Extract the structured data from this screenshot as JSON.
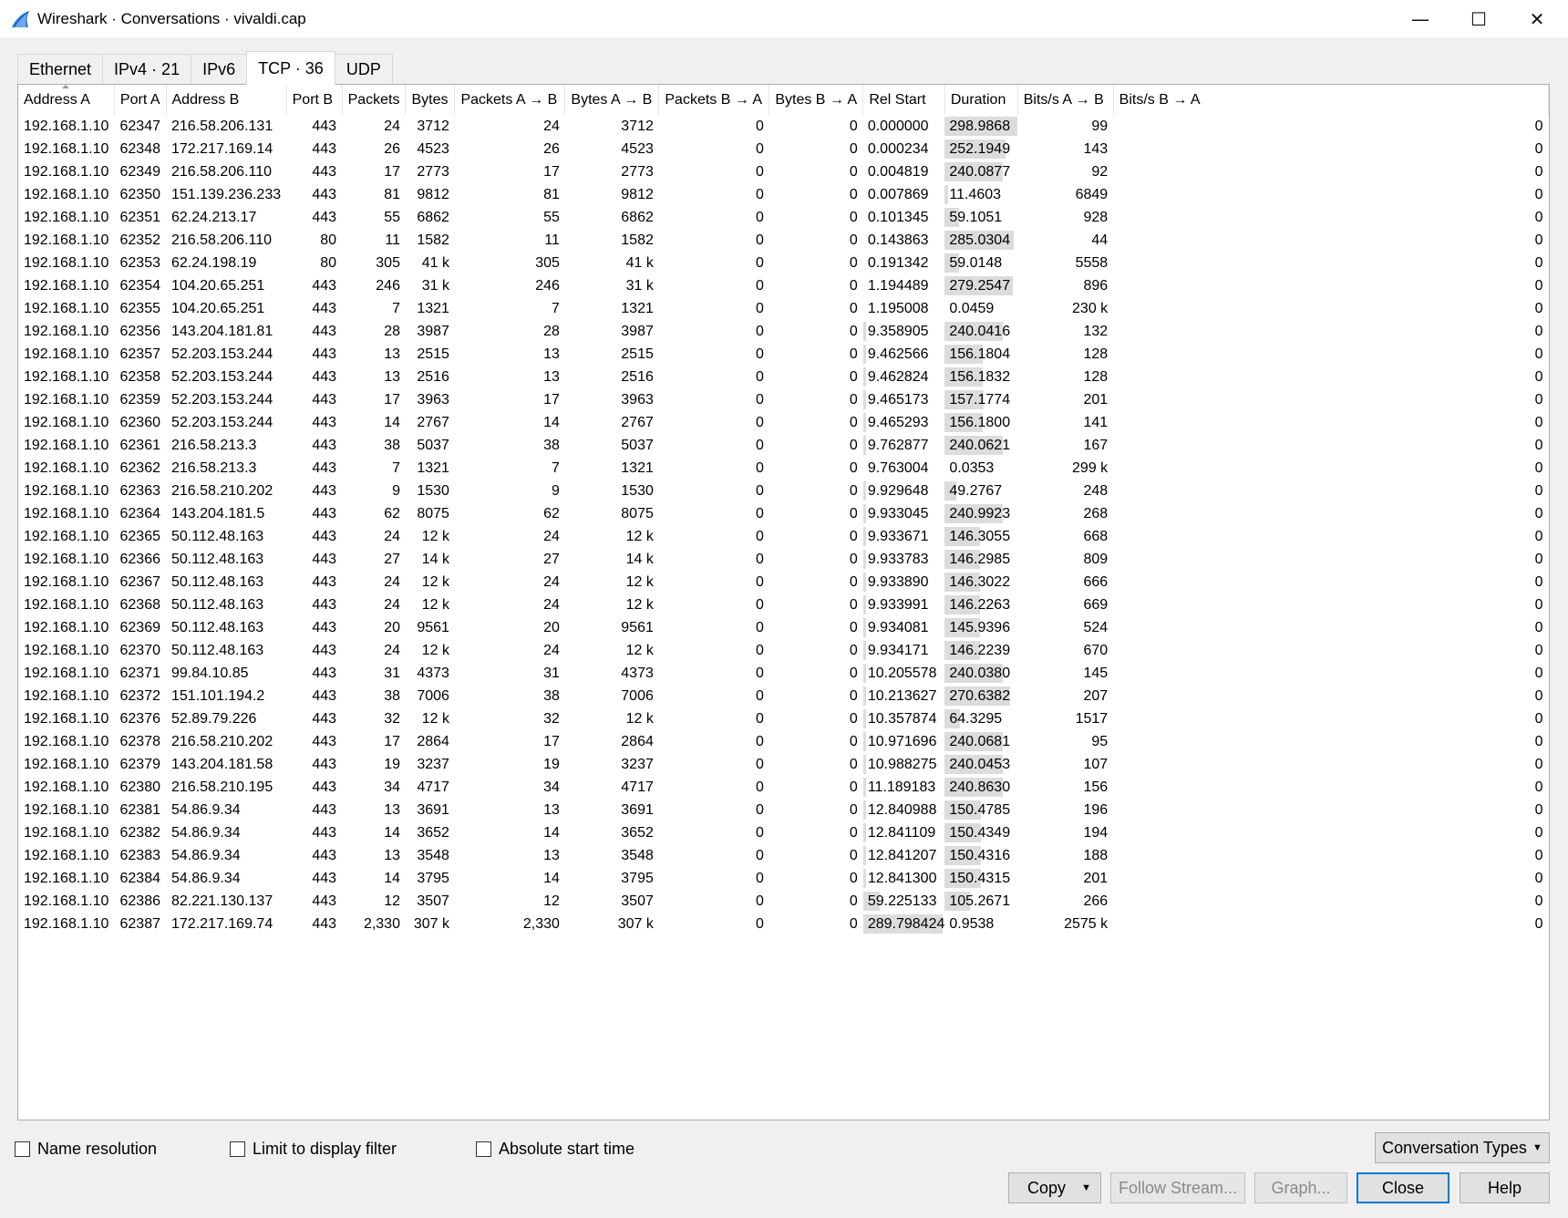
{
  "window": {
    "title": "Wireshark · Conversations · vivaldi.cap",
    "minimize_glyph": "—",
    "maximize_glyph": "☐",
    "close_glyph": "✕"
  },
  "tabs": [
    {
      "label": "Ethernet",
      "active": false
    },
    {
      "label": "IPv4 · 21",
      "active": false
    },
    {
      "label": "IPv6",
      "active": false
    },
    {
      "label": "TCP · 36",
      "active": true
    },
    {
      "label": "UDP",
      "active": false
    }
  ],
  "columns": [
    "Address A",
    "Port A",
    "Address B",
    "Port B",
    "Packets",
    "Bytes",
    "Packets A → B",
    "Bytes A → B",
    "Packets B → A",
    "Bytes B → A",
    "Rel Start",
    "Duration",
    "Bits/s A → B",
    "Bits/s B → A"
  ],
  "rows": [
    [
      "192.168.1.10",
      "62347",
      "216.58.206.131",
      "443",
      "24",
      "3712",
      "24",
      "3712",
      "0",
      "0",
      "0.000000",
      "298.9868",
      "99",
      "0"
    ],
    [
      "192.168.1.10",
      "62348",
      "172.217.169.14",
      "443",
      "26",
      "4523",
      "26",
      "4523",
      "0",
      "0",
      "0.000234",
      "252.1949",
      "143",
      "0"
    ],
    [
      "192.168.1.10",
      "62349",
      "216.58.206.110",
      "443",
      "17",
      "2773",
      "17",
      "2773",
      "0",
      "0",
      "0.004819",
      "240.0877",
      "92",
      "0"
    ],
    [
      "192.168.1.10",
      "62350",
      "151.139.236.233",
      "443",
      "81",
      "9812",
      "81",
      "9812",
      "0",
      "0",
      "0.007869",
      "11.4603",
      "6849",
      "0"
    ],
    [
      "192.168.1.10",
      "62351",
      "62.24.213.17",
      "443",
      "55",
      "6862",
      "55",
      "6862",
      "0",
      "0",
      "0.101345",
      "59.1051",
      "928",
      "0"
    ],
    [
      "192.168.1.10",
      "62352",
      "216.58.206.110",
      "80",
      "11",
      "1582",
      "11",
      "1582",
      "0",
      "0",
      "0.143863",
      "285.0304",
      "44",
      "0"
    ],
    [
      "192.168.1.10",
      "62353",
      "62.24.198.19",
      "80",
      "305",
      "41 k",
      "305",
      "41 k",
      "0",
      "0",
      "0.191342",
      "59.0148",
      "5558",
      "0"
    ],
    [
      "192.168.1.10",
      "62354",
      "104.20.65.251",
      "443",
      "246",
      "31 k",
      "246",
      "31 k",
      "0",
      "0",
      "1.194489",
      "279.2547",
      "896",
      "0"
    ],
    [
      "192.168.1.10",
      "62355",
      "104.20.65.251",
      "443",
      "7",
      "1321",
      "7",
      "1321",
      "0",
      "0",
      "1.195008",
      "0.0459",
      "230 k",
      "0"
    ],
    [
      "192.168.1.10",
      "62356",
      "143.204.181.81",
      "443",
      "28",
      "3987",
      "28",
      "3987",
      "0",
      "0",
      "9.358905",
      "240.0416",
      "132",
      "0"
    ],
    [
      "192.168.1.10",
      "62357",
      "52.203.153.244",
      "443",
      "13",
      "2515",
      "13",
      "2515",
      "0",
      "0",
      "9.462566",
      "156.1804",
      "128",
      "0"
    ],
    [
      "192.168.1.10",
      "62358",
      "52.203.153.244",
      "443",
      "13",
      "2516",
      "13",
      "2516",
      "0",
      "0",
      "9.462824",
      "156.1832",
      "128",
      "0"
    ],
    [
      "192.168.1.10",
      "62359",
      "52.203.153.244",
      "443",
      "17",
      "3963",
      "17",
      "3963",
      "0",
      "0",
      "9.465173",
      "157.1774",
      "201",
      "0"
    ],
    [
      "192.168.1.10",
      "62360",
      "52.203.153.244",
      "443",
      "14",
      "2767",
      "14",
      "2767",
      "0",
      "0",
      "9.465293",
      "156.1800",
      "141",
      "0"
    ],
    [
      "192.168.1.10",
      "62361",
      "216.58.213.3",
      "443",
      "38",
      "5037",
      "38",
      "5037",
      "0",
      "0",
      "9.762877",
      "240.0621",
      "167",
      "0"
    ],
    [
      "192.168.1.10",
      "62362",
      "216.58.213.3",
      "443",
      "7",
      "1321",
      "7",
      "1321",
      "0",
      "0",
      "9.763004",
      "0.0353",
      "299 k",
      "0"
    ],
    [
      "192.168.1.10",
      "62363",
      "216.58.210.202",
      "443",
      "9",
      "1530",
      "9",
      "1530",
      "0",
      "0",
      "9.929648",
      "49.2767",
      "248",
      "0"
    ],
    [
      "192.168.1.10",
      "62364",
      "143.204.181.5",
      "443",
      "62",
      "8075",
      "62",
      "8075",
      "0",
      "0",
      "9.933045",
      "240.9923",
      "268",
      "0"
    ],
    [
      "192.168.1.10",
      "62365",
      "50.112.48.163",
      "443",
      "24",
      "12 k",
      "24",
      "12 k",
      "0",
      "0",
      "9.933671",
      "146.3055",
      "668",
      "0"
    ],
    [
      "192.168.1.10",
      "62366",
      "50.112.48.163",
      "443",
      "27",
      "14 k",
      "27",
      "14 k",
      "0",
      "0",
      "9.933783",
      "146.2985",
      "809",
      "0"
    ],
    [
      "192.168.1.10",
      "62367",
      "50.112.48.163",
      "443",
      "24",
      "12 k",
      "24",
      "12 k",
      "0",
      "0",
      "9.933890",
      "146.3022",
      "666",
      "0"
    ],
    [
      "192.168.1.10",
      "62368",
      "50.112.48.163",
      "443",
      "24",
      "12 k",
      "24",
      "12 k",
      "0",
      "0",
      "9.933991",
      "146.2263",
      "669",
      "0"
    ],
    [
      "192.168.1.10",
      "62369",
      "50.112.48.163",
      "443",
      "20",
      "9561",
      "20",
      "9561",
      "0",
      "0",
      "9.934081",
      "145.9396",
      "524",
      "0"
    ],
    [
      "192.168.1.10",
      "62370",
      "50.112.48.163",
      "443",
      "24",
      "12 k",
      "24",
      "12 k",
      "0",
      "0",
      "9.934171",
      "146.2239",
      "670",
      "0"
    ],
    [
      "192.168.1.10",
      "62371",
      "99.84.10.85",
      "443",
      "31",
      "4373",
      "31",
      "4373",
      "0",
      "0",
      "10.205578",
      "240.0380",
      "145",
      "0"
    ],
    [
      "192.168.1.10",
      "62372",
      "151.101.194.2",
      "443",
      "38",
      "7006",
      "38",
      "7006",
      "0",
      "0",
      "10.213627",
      "270.6382",
      "207",
      "0"
    ],
    [
      "192.168.1.10",
      "62376",
      "52.89.79.226",
      "443",
      "32",
      "12 k",
      "32",
      "12 k",
      "0",
      "0",
      "10.357874",
      "64.3295",
      "1517",
      "0"
    ],
    [
      "192.168.1.10",
      "62378",
      "216.58.210.202",
      "443",
      "17",
      "2864",
      "17",
      "2864",
      "0",
      "0",
      "10.971696",
      "240.0681",
      "95",
      "0"
    ],
    [
      "192.168.1.10",
      "62379",
      "143.204.181.58",
      "443",
      "19",
      "3237",
      "19",
      "3237",
      "0",
      "0",
      "10.988275",
      "240.0453",
      "107",
      "0"
    ],
    [
      "192.168.1.10",
      "62380",
      "216.58.210.195",
      "443",
      "34",
      "4717",
      "34",
      "4717",
      "0",
      "0",
      "11.189183",
      "240.8630",
      "156",
      "0"
    ],
    [
      "192.168.1.10",
      "62381",
      "54.86.9.34",
      "443",
      "13",
      "3691",
      "13",
      "3691",
      "0",
      "0",
      "12.840988",
      "150.4785",
      "196",
      "0"
    ],
    [
      "192.168.1.10",
      "62382",
      "54.86.9.34",
      "443",
      "14",
      "3652",
      "14",
      "3652",
      "0",
      "0",
      "12.841109",
      "150.4349",
      "194",
      "0"
    ],
    [
      "192.168.1.10",
      "62383",
      "54.86.9.34",
      "443",
      "13",
      "3548",
      "13",
      "3548",
      "0",
      "0",
      "12.841207",
      "150.4316",
      "188",
      "0"
    ],
    [
      "192.168.1.10",
      "62384",
      "54.86.9.34",
      "443",
      "14",
      "3795",
      "14",
      "3795",
      "0",
      "0",
      "12.841300",
      "150.4315",
      "201",
      "0"
    ],
    [
      "192.168.1.10",
      "62386",
      "82.221.130.137",
      "443",
      "12",
      "3507",
      "12",
      "3507",
      "0",
      "0",
      "59.225133",
      "105.2671",
      "266",
      "0"
    ],
    [
      "192.168.1.10",
      "62387",
      "172.217.169.74",
      "443",
      "2,330",
      "307 k",
      "2,330",
      "307 k",
      "0",
      "0",
      "289.798424",
      "0.9538",
      "2575 k",
      "0"
    ]
  ],
  "timeline_bars": [
    [
      0.0,
      1.0
    ],
    [
      0.0,
      0.84
    ],
    [
      0.0,
      0.8
    ],
    [
      0.0,
      0.04
    ],
    [
      0.0,
      0.2
    ],
    [
      0.0,
      0.95
    ],
    [
      0.0,
      0.2
    ],
    [
      0.0,
      0.93
    ],
    [
      0.0,
      0.0
    ],
    [
      0.03,
      0.8
    ],
    [
      0.03,
      0.52
    ],
    [
      0.03,
      0.52
    ],
    [
      0.03,
      0.53
    ],
    [
      0.03,
      0.52
    ],
    [
      0.03,
      0.8
    ],
    [
      0.0,
      0.0
    ],
    [
      0.03,
      0.16
    ],
    [
      0.03,
      0.8
    ],
    [
      0.03,
      0.49
    ],
    [
      0.03,
      0.49
    ],
    [
      0.03,
      0.49
    ],
    [
      0.03,
      0.49
    ],
    [
      0.03,
      0.49
    ],
    [
      0.03,
      0.49
    ],
    [
      0.03,
      0.8
    ],
    [
      0.03,
      0.9
    ],
    [
      0.03,
      0.21
    ],
    [
      0.04,
      0.8
    ],
    [
      0.04,
      0.8
    ],
    [
      0.04,
      0.8
    ],
    [
      0.04,
      0.5
    ],
    [
      0.04,
      0.5
    ],
    [
      0.04,
      0.5
    ],
    [
      0.04,
      0.5
    ],
    [
      0.2,
      0.35
    ],
    [
      0.97,
      0.0
    ]
  ],
  "options": {
    "name_resolution": {
      "label": "Name resolution",
      "checked": false
    },
    "limit_filter": {
      "label": "Limit to display filter",
      "checked": false
    },
    "absolute_time": {
      "label": "Absolute start time",
      "checked": false
    }
  },
  "buttons": {
    "conversation_types": "Conversation Types",
    "copy": "Copy",
    "follow_stream": "Follow Stream...",
    "graph": "Graph...",
    "close": "Close",
    "help": "Help"
  },
  "colors": {
    "accent": "#0078d7",
    "timeline_bar": "#dcdcdc",
    "app_icon": "#1e6fd0"
  }
}
